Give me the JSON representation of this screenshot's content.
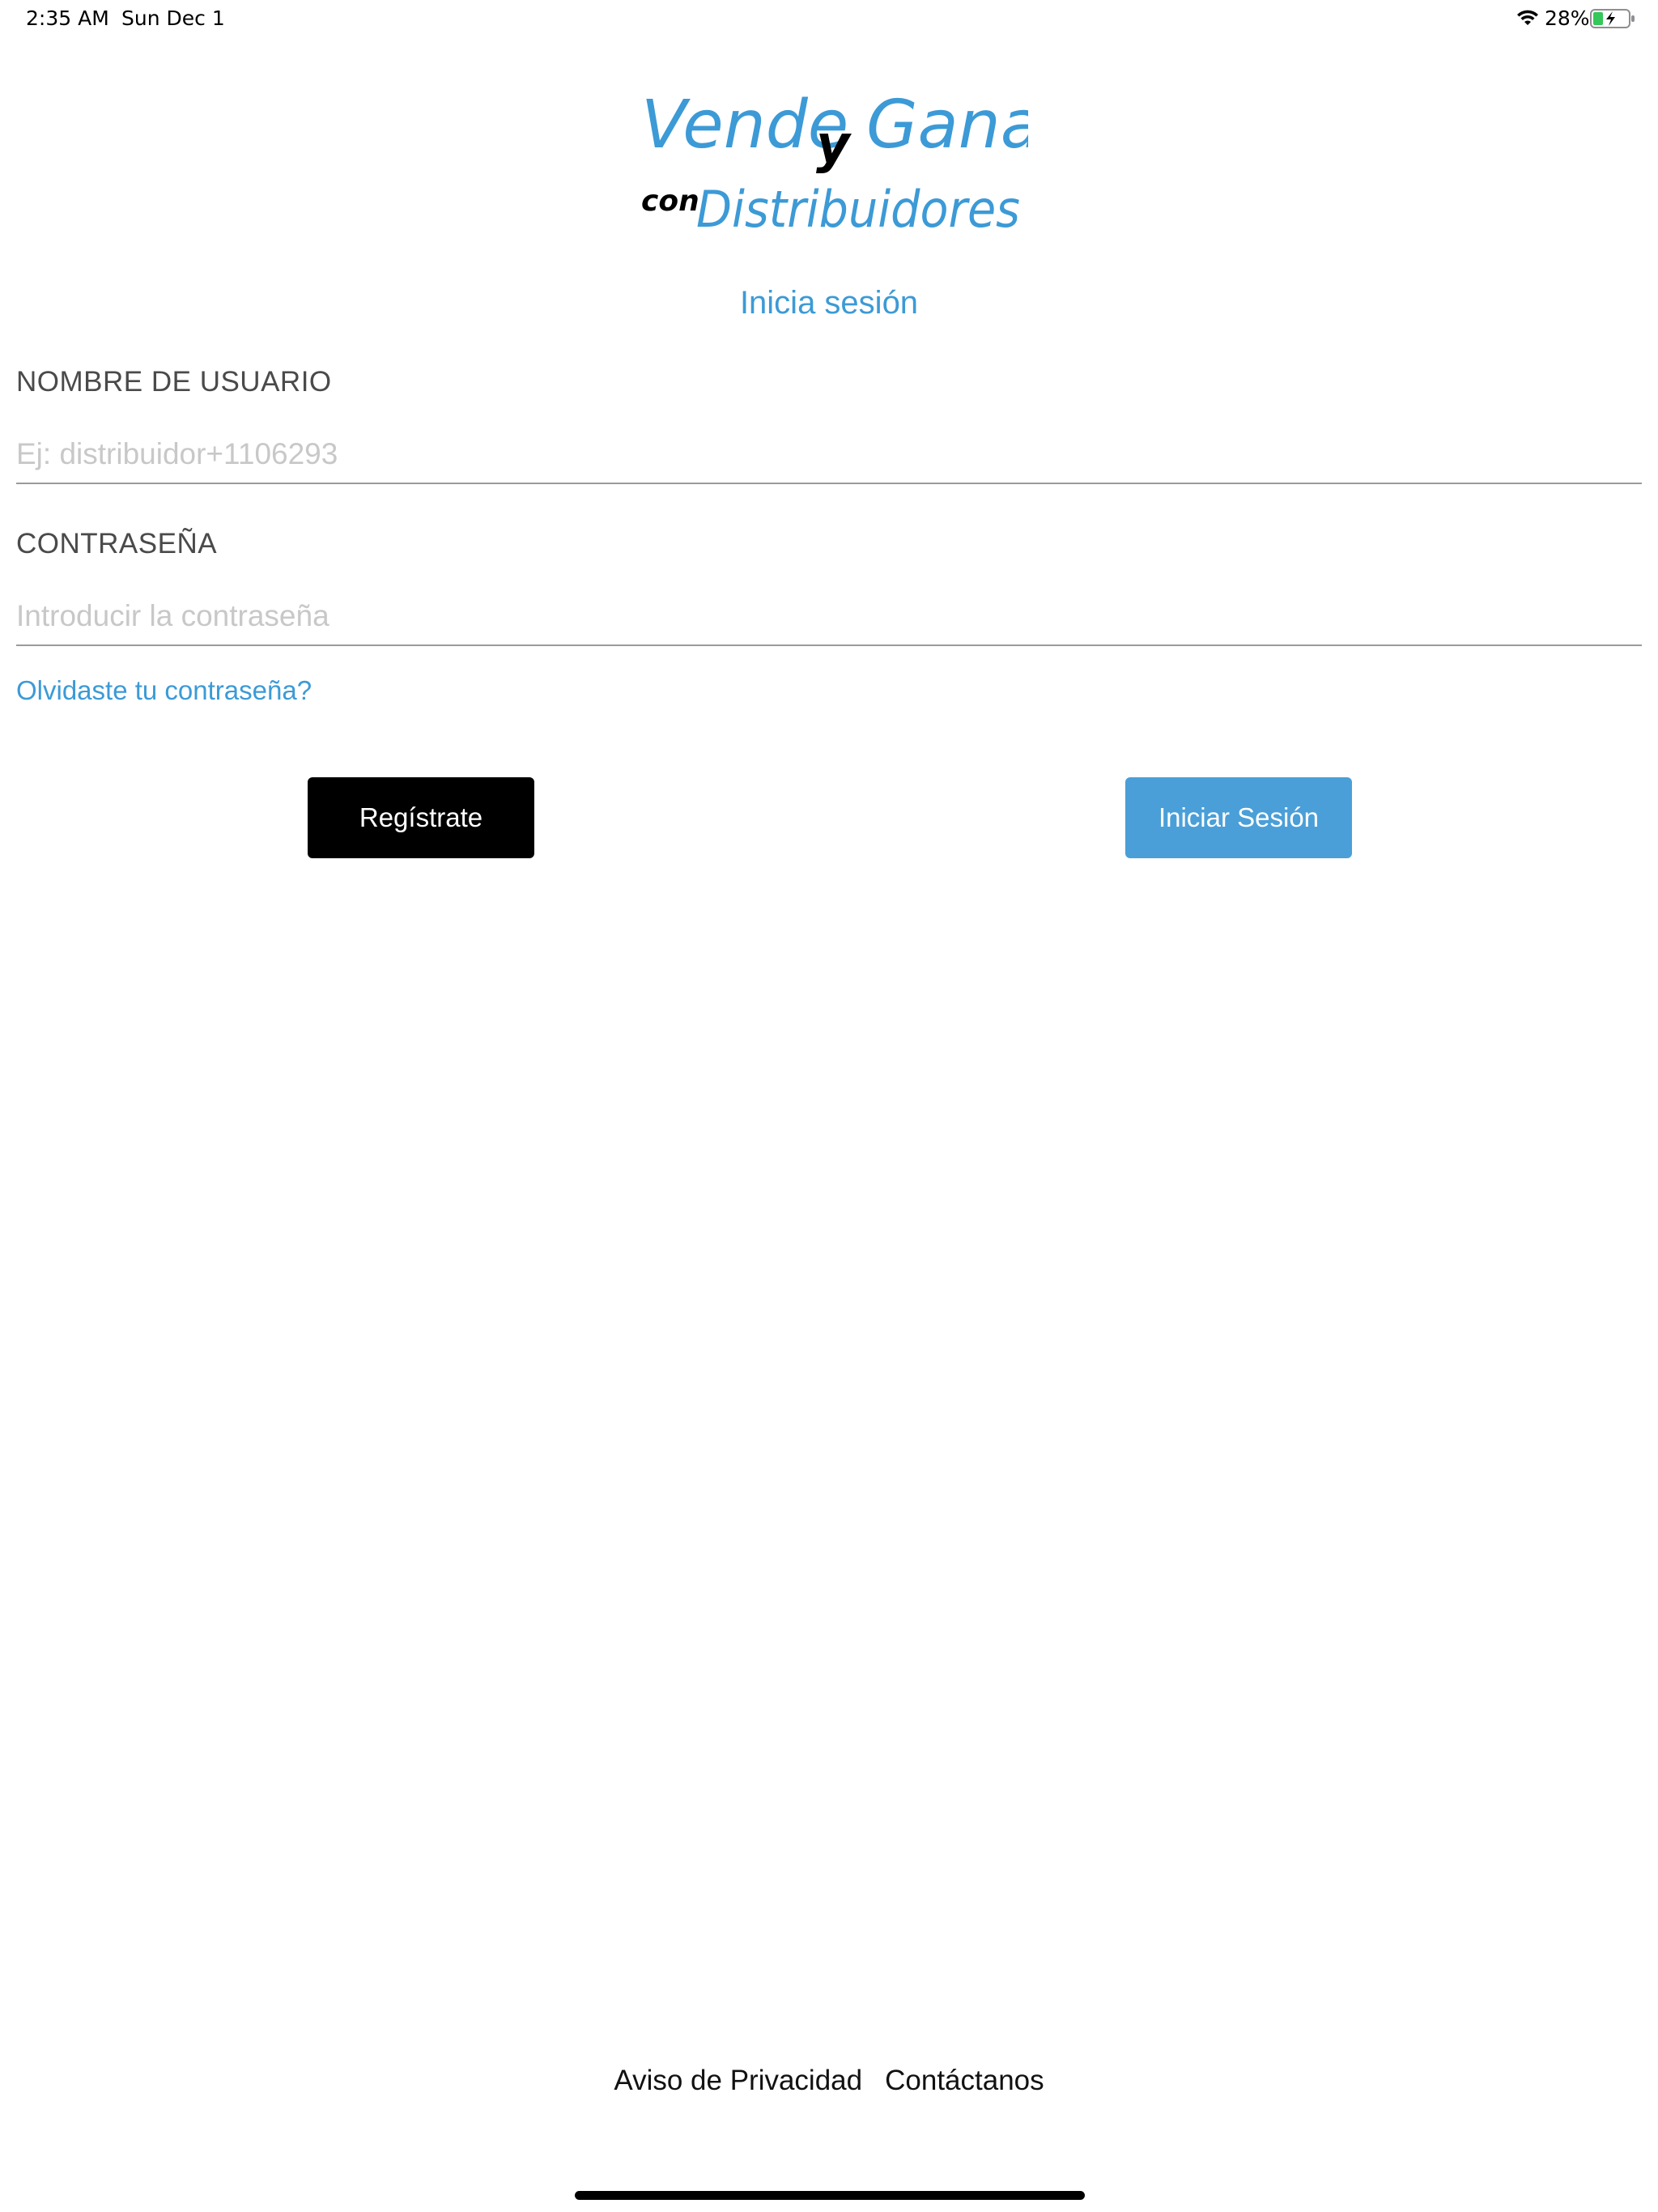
{
  "status_bar": {
    "time": "2:35 AM",
    "date": "Sun Dec 1",
    "battery_percent": "28%",
    "battery_level": 0.28,
    "battery_color": "#34c759"
  },
  "logo": {
    "line1_word1": "Vende",
    "line1_word2": "y",
    "line1_word3": "Gana",
    "line2_small": "con",
    "line2_word": "Distribuidores",
    "accent_color": "#3c9ad6"
  },
  "login": {
    "title": "Inicia sesión",
    "username_label": "NOMBRE DE USUARIO",
    "username_placeholder": "Ej: distribuidor+1106293",
    "username_value": "",
    "password_label": "CONTRASEÑA",
    "password_placeholder": "Introducir la contraseña",
    "password_value": "",
    "forgot_password": "Olvidaste tu contraseña?",
    "register_button": "Regístrate",
    "login_button": "Iniciar Sesión"
  },
  "footer": {
    "privacy": "Aviso de Privacidad",
    "contact": "Contáctanos"
  }
}
